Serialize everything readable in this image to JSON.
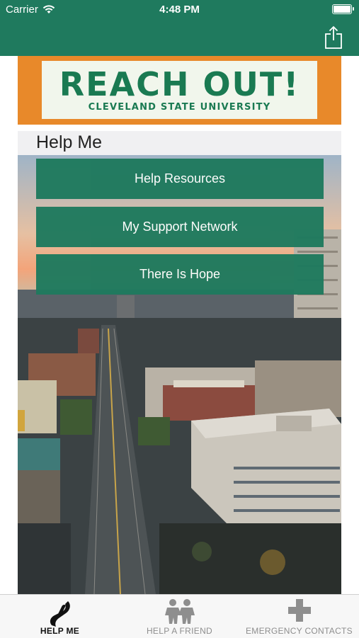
{
  "status_bar": {
    "carrier": "Carrier",
    "time": "4:48 PM"
  },
  "banner": {
    "title": "REACH OUT!",
    "subtitle": "CLEVELAND STATE UNIVERSITY"
  },
  "section": {
    "title": "Help Me"
  },
  "buttons": [
    {
      "label": "Help Resources"
    },
    {
      "label": "My Support Network"
    },
    {
      "label": "There Is Hope"
    }
  ],
  "tabs": [
    {
      "label": "HELP ME",
      "icon": "hands-icon",
      "active": true
    },
    {
      "label": "HELP A FRIEND",
      "icon": "friends-icon",
      "active": false
    },
    {
      "label": "EMERGENCY CONTACTS",
      "icon": "cross-icon",
      "active": false
    }
  ],
  "colors": {
    "brand_green": "#1f7a5e",
    "banner_orange": "#e8892a",
    "tab_active": "#111111",
    "tab_inactive": "#8e8e8e"
  }
}
